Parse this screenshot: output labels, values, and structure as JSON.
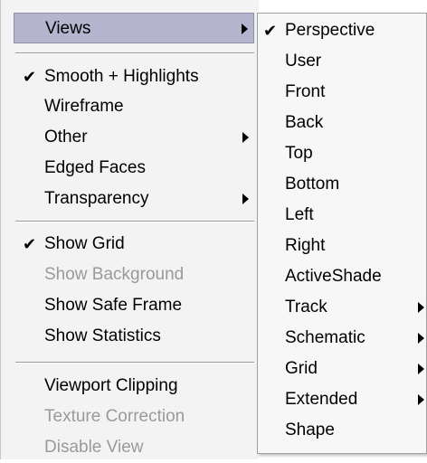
{
  "main_menu": {
    "views_label": "Views",
    "smooth_highlights_label": "Smooth + Highlights",
    "wireframe_label": "Wireframe",
    "other_label": "Other",
    "edged_faces_label": "Edged Faces",
    "transparency_label": "Transparency",
    "show_grid_label": "Show Grid",
    "show_background_label": "Show Background",
    "show_safe_frame_label": "Show Safe Frame",
    "show_statistics_label": "Show Statistics",
    "viewport_clipping_label": "Viewport Clipping",
    "texture_correction_label": "Texture Correction",
    "disable_view_label": "Disable View"
  },
  "views_submenu": {
    "perspective_label": "Perspective",
    "user_label": "User",
    "front_label": "Front",
    "back_label": "Back",
    "top_label": "Top",
    "bottom_label": "Bottom",
    "left_label": "Left",
    "right_label": "Right",
    "activeshade_label": "ActiveShade",
    "track_label": "Track",
    "schematic_label": "Schematic",
    "grid_label": "Grid",
    "extended_label": "Extended",
    "shape_label": "Shape"
  },
  "icons": {
    "check": "✔",
    "submenu_arrow": "triangle-right"
  },
  "colors": {
    "highlight": "#b5b5cf",
    "disabled_text": "#9a9a9a",
    "menu_background": "#f3f3f3"
  }
}
